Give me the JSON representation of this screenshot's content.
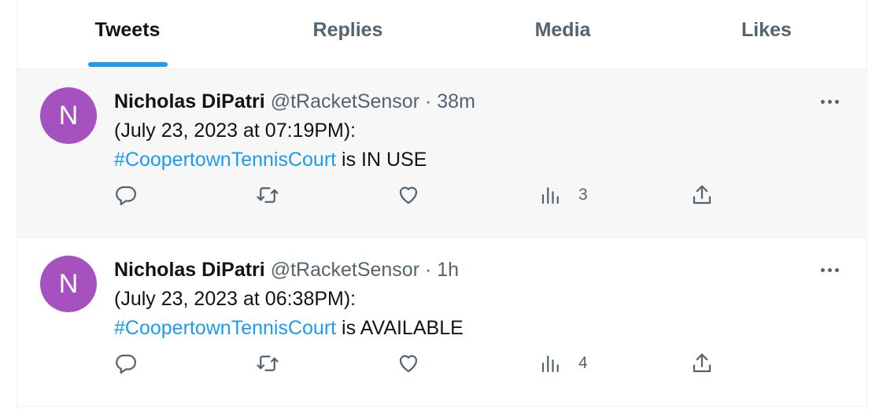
{
  "tabs": [
    {
      "label": "Tweets",
      "active": true
    },
    {
      "label": "Replies",
      "active": false
    },
    {
      "label": "Media",
      "active": false
    },
    {
      "label": "Likes",
      "active": false
    }
  ],
  "tweets": [
    {
      "avatar_letter": "N",
      "name": "Nicholas DiPatri",
      "handle": "@tRacketSensor",
      "separator": "·",
      "time": "38m",
      "line1": "(July 23, 2023 at 07:19PM):",
      "hashtag": "#CoopertownTennisCourt",
      "status_text": " is IN USE",
      "views": "3",
      "hovered": true
    },
    {
      "avatar_letter": "N",
      "name": "Nicholas DiPatri",
      "handle": "@tRacketSensor",
      "separator": "·",
      "time": "1h",
      "line1": "(July 23, 2023 at 06:38PM):",
      "hashtag": "#CoopertownTennisCourt",
      "status_text": " is AVAILABLE",
      "views": "4",
      "hovered": false
    }
  ],
  "icons": {
    "reply": "reply-icon",
    "retweet": "retweet-icon",
    "like": "heart-icon",
    "views": "views-chart-icon",
    "share": "share-icon",
    "more": "more-icon"
  },
  "colors": {
    "accent": "#1d9bf0",
    "avatar": "#a552c0",
    "muted": "#536471",
    "hover_bg": "#f7f7f7"
  }
}
